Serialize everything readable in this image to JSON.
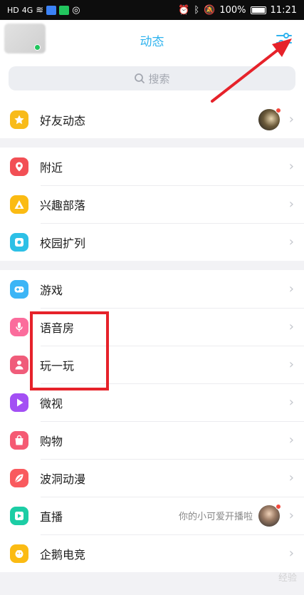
{
  "statusbar": {
    "battery_text": "100%",
    "time": "11:21",
    "signal_text": "HD",
    "network_text": "4G"
  },
  "header": {
    "title": "动态"
  },
  "search": {
    "placeholder": "搜索"
  },
  "groups": [
    [
      {
        "label": "好友动态",
        "icon": "star-icon",
        "color": "#f8bb1a",
        "thumb": "friend-thumb"
      }
    ],
    [
      {
        "label": "附近",
        "icon": "location-pin-icon",
        "color": "#f24f55"
      },
      {
        "label": "兴趣部落",
        "icon": "triangle-tribe-icon",
        "color": "#fbbb13"
      },
      {
        "label": "校园扩列",
        "icon": "campus-icon",
        "color": "#2dc0e6"
      }
    ],
    [
      {
        "label": "游戏",
        "icon": "gamepad-icon",
        "color": "#3cb5f6"
      },
      {
        "label": "语音房",
        "icon": "microphone-icon",
        "color": "#fb6c9c"
      },
      {
        "label": "玩一玩",
        "icon": "person-play-icon",
        "color": "#f05c7a"
      },
      {
        "label": "微视",
        "icon": "play-icon",
        "color": "#a34ff4"
      },
      {
        "label": "购物",
        "icon": "shopping-bag-icon",
        "color": "#f55a73"
      },
      {
        "label": "波洞动漫",
        "icon": "leaf-comic-icon",
        "color": "#f95a5e"
      },
      {
        "label": "直播",
        "icon": "live-icon",
        "color": "#1ccda5",
        "extra": "你的小可爱开播啦",
        "thumb": "live-thumb"
      },
      {
        "label": "企鹅电竞",
        "icon": "esports-icon",
        "color": "#fbbb13"
      }
    ]
  ],
  "watermark": "经验"
}
